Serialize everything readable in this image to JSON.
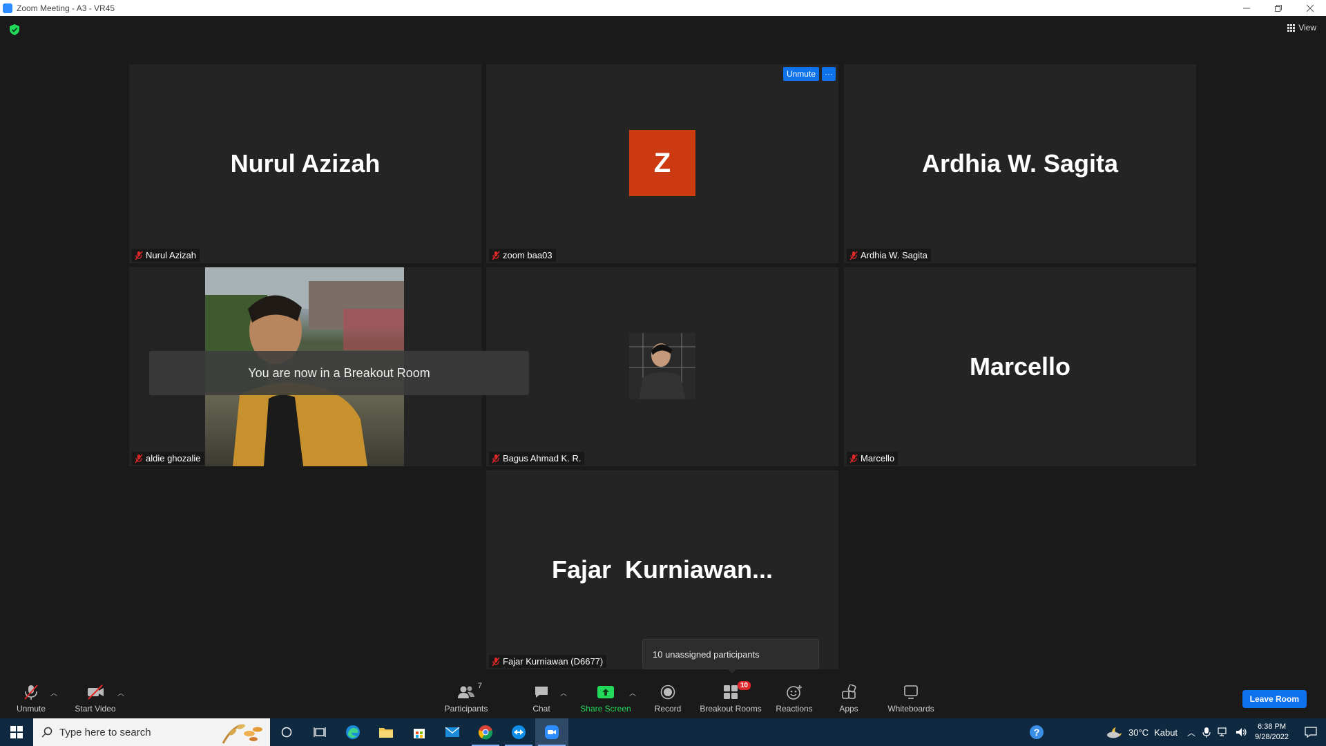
{
  "window": {
    "title": "Zoom Meeting - A3 - VR45"
  },
  "view_button": {
    "label": "View"
  },
  "tiles": [
    {
      "display_name": "Nurul Azizah",
      "name_tag": "Nurul Azizah"
    },
    {
      "avatar_letter": "Z",
      "name_tag": "zoom baa03",
      "unmute_label": "Unmute",
      "more_label": "···"
    },
    {
      "display_name": "Ardhia W. Sagita",
      "name_tag": "Ardhia W. Sagita"
    },
    {
      "name_tag": "aldie ghozalie"
    },
    {
      "name_tag": "Bagus Ahmad K. R."
    },
    {
      "display_name": "Marcello",
      "name_tag": "Marcello"
    },
    {
      "display_name": "Fajar  Kurniawan...",
      "name_tag": "Fajar Kurniawan (D6677)"
    }
  ],
  "toast": {
    "text": "You are now in a Breakout Room"
  },
  "tooltip": {
    "text": "10 unassigned participants"
  },
  "toolbar": {
    "unmute": "Unmute",
    "start_video": "Start Video",
    "participants": "Participants",
    "participants_count": "7",
    "chat": "Chat",
    "share_screen": "Share Screen",
    "record": "Record",
    "breakout_rooms": "Breakout Rooms",
    "breakout_count": "10",
    "reactions": "Reactions",
    "apps": "Apps",
    "whiteboards": "Whiteboards",
    "leave_room": "Leave Room"
  },
  "taskbar": {
    "search_placeholder": "Type here to search",
    "weather_temp": "30°C",
    "weather_desc": "Kabut",
    "time": "6:38 PM",
    "date": "9/28/2022"
  },
  "colors": {
    "accent": "#0e72ed",
    "share_green": "#23d959",
    "avatar_orange": "#cc3a12",
    "muted_red": "#e02828",
    "tile_bg": "#242424",
    "app_bg": "#1a1a1a"
  }
}
